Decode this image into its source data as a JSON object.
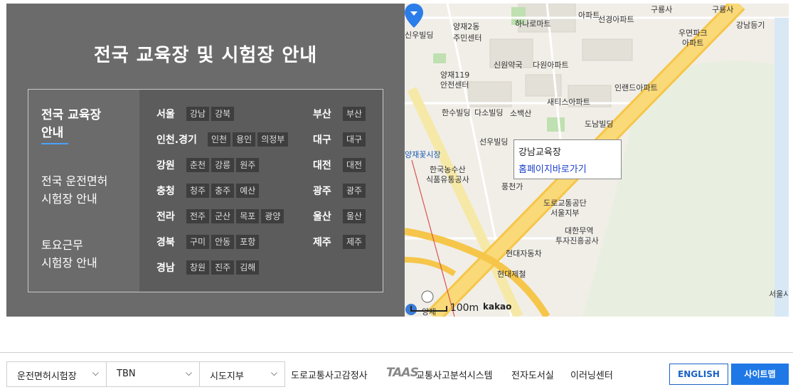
{
  "panel": {
    "title": "전국 교육장 및 시험장 안내",
    "menu": [
      {
        "line1": "전국 교육장",
        "line2": "안내"
      },
      {
        "line1": "전국 운전면허",
        "line2": "시험장 안내"
      },
      {
        "line1": "토요근무",
        "line2": "시험장 안내"
      }
    ],
    "regions_left": [
      {
        "name": "서울",
        "tags": [
          "강남",
          "강북"
        ]
      },
      {
        "name": "인천.경기",
        "tags": [
          "인천",
          "용인",
          "의정부"
        ]
      },
      {
        "name": "강원",
        "tags": [
          "춘천",
          "강릉",
          "원주"
        ]
      },
      {
        "name": "충청",
        "tags": [
          "청주",
          "충주",
          "예산"
        ]
      },
      {
        "name": "전라",
        "tags": [
          "전주",
          "군산",
          "목포",
          "광양"
        ]
      },
      {
        "name": "경북",
        "tags": [
          "구미",
          "안동",
          "포항"
        ]
      },
      {
        "name": "경남",
        "tags": [
          "창원",
          "진주",
          "김해"
        ]
      }
    ],
    "regions_right": [
      {
        "name": "부산",
        "tags": [
          "부산"
        ]
      },
      {
        "name": "대구",
        "tags": [
          "대구"
        ]
      },
      {
        "name": "대전",
        "tags": [
          "대전"
        ]
      },
      {
        "name": "광주",
        "tags": [
          "광주"
        ]
      },
      {
        "name": "울산",
        "tags": [
          "울산"
        ]
      },
      {
        "name": "제주",
        "tags": [
          "제주"
        ]
      }
    ]
  },
  "map": {
    "popup_title": "강남교육장",
    "popup_link": "홈페이지바로가기",
    "scale": "100m",
    "provider": "kakao",
    "labels": {
      "l1": "양재2동",
      "l2": "주민센터",
      "l3": "하나로마트",
      "l4": "선경아파트",
      "l5": "우면파크",
      "l6": "아파트",
      "l7": "강남등기",
      "l8": "양재119",
      "l9": "안전센터",
      "l10": "신원약국",
      "l11": "다원아파트",
      "l12": "인랜드아파트",
      "l13": "새티스아파트",
      "l14": "한수빌딩",
      "l15": "다소빌딩",
      "l16": "소백산",
      "l17": "도남빌딩",
      "l18": "선우빌딩",
      "l19": "한국농수산",
      "l20": "식품유통공사",
      "l21": "풍천가",
      "l22": "도로교통공단",
      "l23": "서울지부",
      "l24": "대한무역",
      "l25": "투자진흥공사",
      "l26": "현대자동차",
      "l27": "현대제철",
      "l28": "신우빌딩",
      "l29": "구룡사",
      "l30": "양재꽃시장",
      "l31": "서울시",
      "l32": "아파트",
      "l33": "구룡사",
      "l34": "양재"
    }
  },
  "footer": {
    "select1": "운전면허시험장",
    "select2": "TBN",
    "select3": "시도지부",
    "link1": "도로교통사고감정사",
    "taas_logo": "TAAS",
    "link2": "교통사고분석시스템",
    "link3": "전자도서실",
    "link4": "이러닝센터",
    "btn_english": "ENGLISH",
    "btn_sitemap": "사이트맵"
  }
}
